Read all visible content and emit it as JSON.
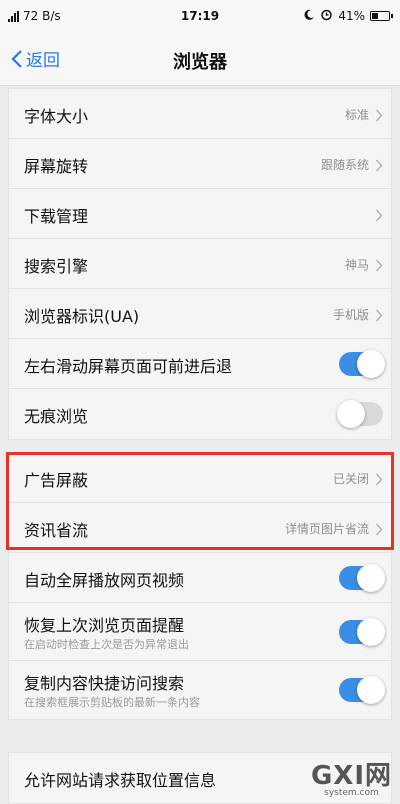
{
  "status": {
    "speed": "72 B/s",
    "time": "17:19",
    "battery": "41%",
    "battery_level": 0.41
  },
  "nav": {
    "back_label": "返回",
    "title": "浏览器"
  },
  "group1": [
    {
      "label": "字体大小",
      "value": "标准",
      "type": "link"
    },
    {
      "label": "屏幕旋转",
      "value": "跟随系统",
      "type": "link"
    },
    {
      "label": "下载管理",
      "value": "",
      "type": "link"
    },
    {
      "label": "搜索引擎",
      "value": "神马",
      "type": "link"
    },
    {
      "label": "浏览器标识(UA)",
      "value": "手机版",
      "type": "link"
    },
    {
      "label": "左右滑动屏幕页面可前进后退",
      "type": "toggle",
      "on": true
    },
    {
      "label": "无痕浏览",
      "type": "toggle",
      "on": false
    }
  ],
  "group2": [
    {
      "label": "广告屏蔽",
      "value": "已关闭",
      "type": "link"
    },
    {
      "label": "资讯省流",
      "value": "详情页图片省流",
      "type": "link"
    },
    {
      "label": "自动全屏播放网页视频",
      "type": "toggle",
      "on": true
    },
    {
      "label": "恢复上次浏览页面提醒",
      "sublabel": "在启动时检查上次是否为异常退出",
      "type": "toggle",
      "on": true
    },
    {
      "label": "复制内容快捷访问搜索",
      "sublabel": "在搜索框展示剪贴板的最新一条内容",
      "type": "toggle",
      "on": true
    }
  ],
  "group3": [
    {
      "label": "允许网站请求获取位置信息"
    }
  ],
  "watermark": {
    "logo": "GXI网",
    "sub": "system.com"
  },
  "colors": {
    "accent": "#3a8ee6",
    "link_blue": "#2a78e4",
    "highlight": "#e8312a"
  }
}
